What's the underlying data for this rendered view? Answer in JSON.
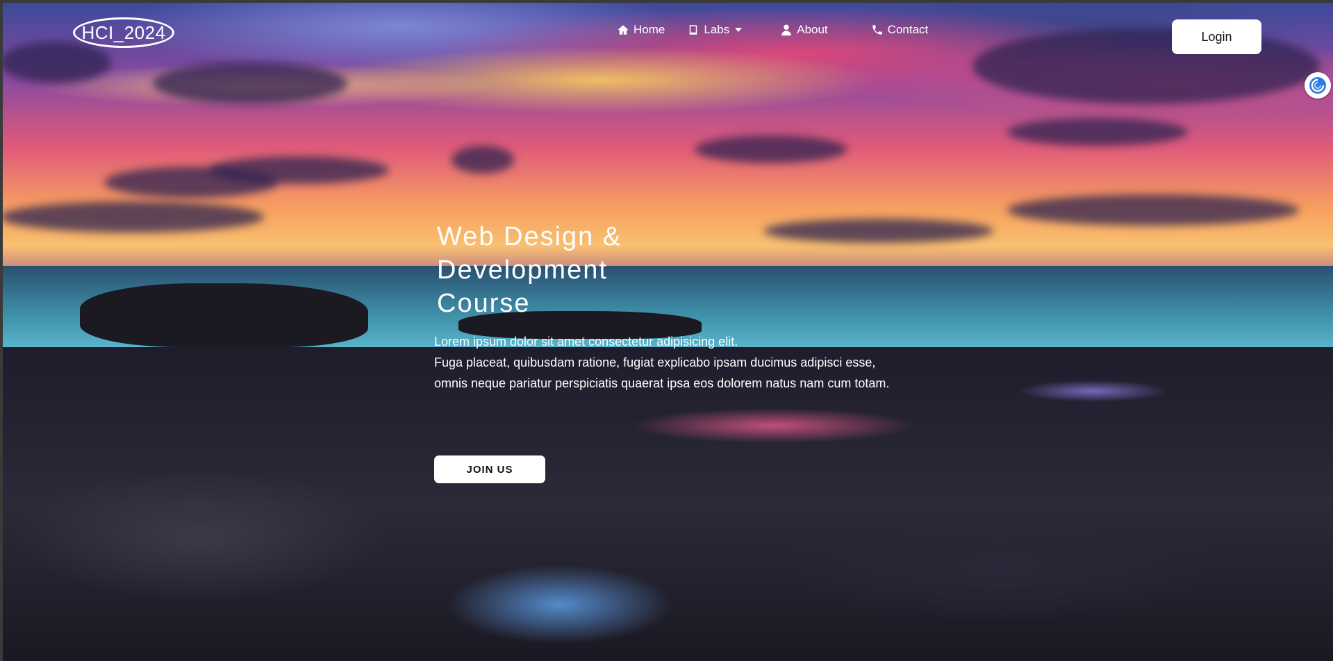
{
  "brand": {
    "logo_text": "HCI_2024"
  },
  "nav": {
    "items": [
      {
        "label": "Home",
        "icon": "home-icon"
      },
      {
        "label": "Labs",
        "icon": "book-icon",
        "has_dropdown": true
      },
      {
        "label": "About",
        "icon": "user-icon"
      },
      {
        "label": "Contact",
        "icon": "phone-icon"
      }
    ],
    "login_label": "Login"
  },
  "hero": {
    "title_lines": [
      "Web Design &",
      "Development",
      "Course"
    ],
    "paragraph_lines": [
      "Lorem ipsum dolor sit amet consectetur adipisicing elit.",
      "Fuga placeat, quibusdam ratione, fugiat explicabo ipsam ducimus adipisci esse,",
      "omnis neque pariatur perspiciatis quaerat ipsa eos dolorem natus nam cum totam."
    ],
    "cta_label": "JOIN US"
  },
  "extension": {
    "icon": "browser-extension-icon"
  },
  "colors": {
    "button_bg": "#ffffff",
    "button_text": "#111111",
    "text": "#ffffff"
  }
}
